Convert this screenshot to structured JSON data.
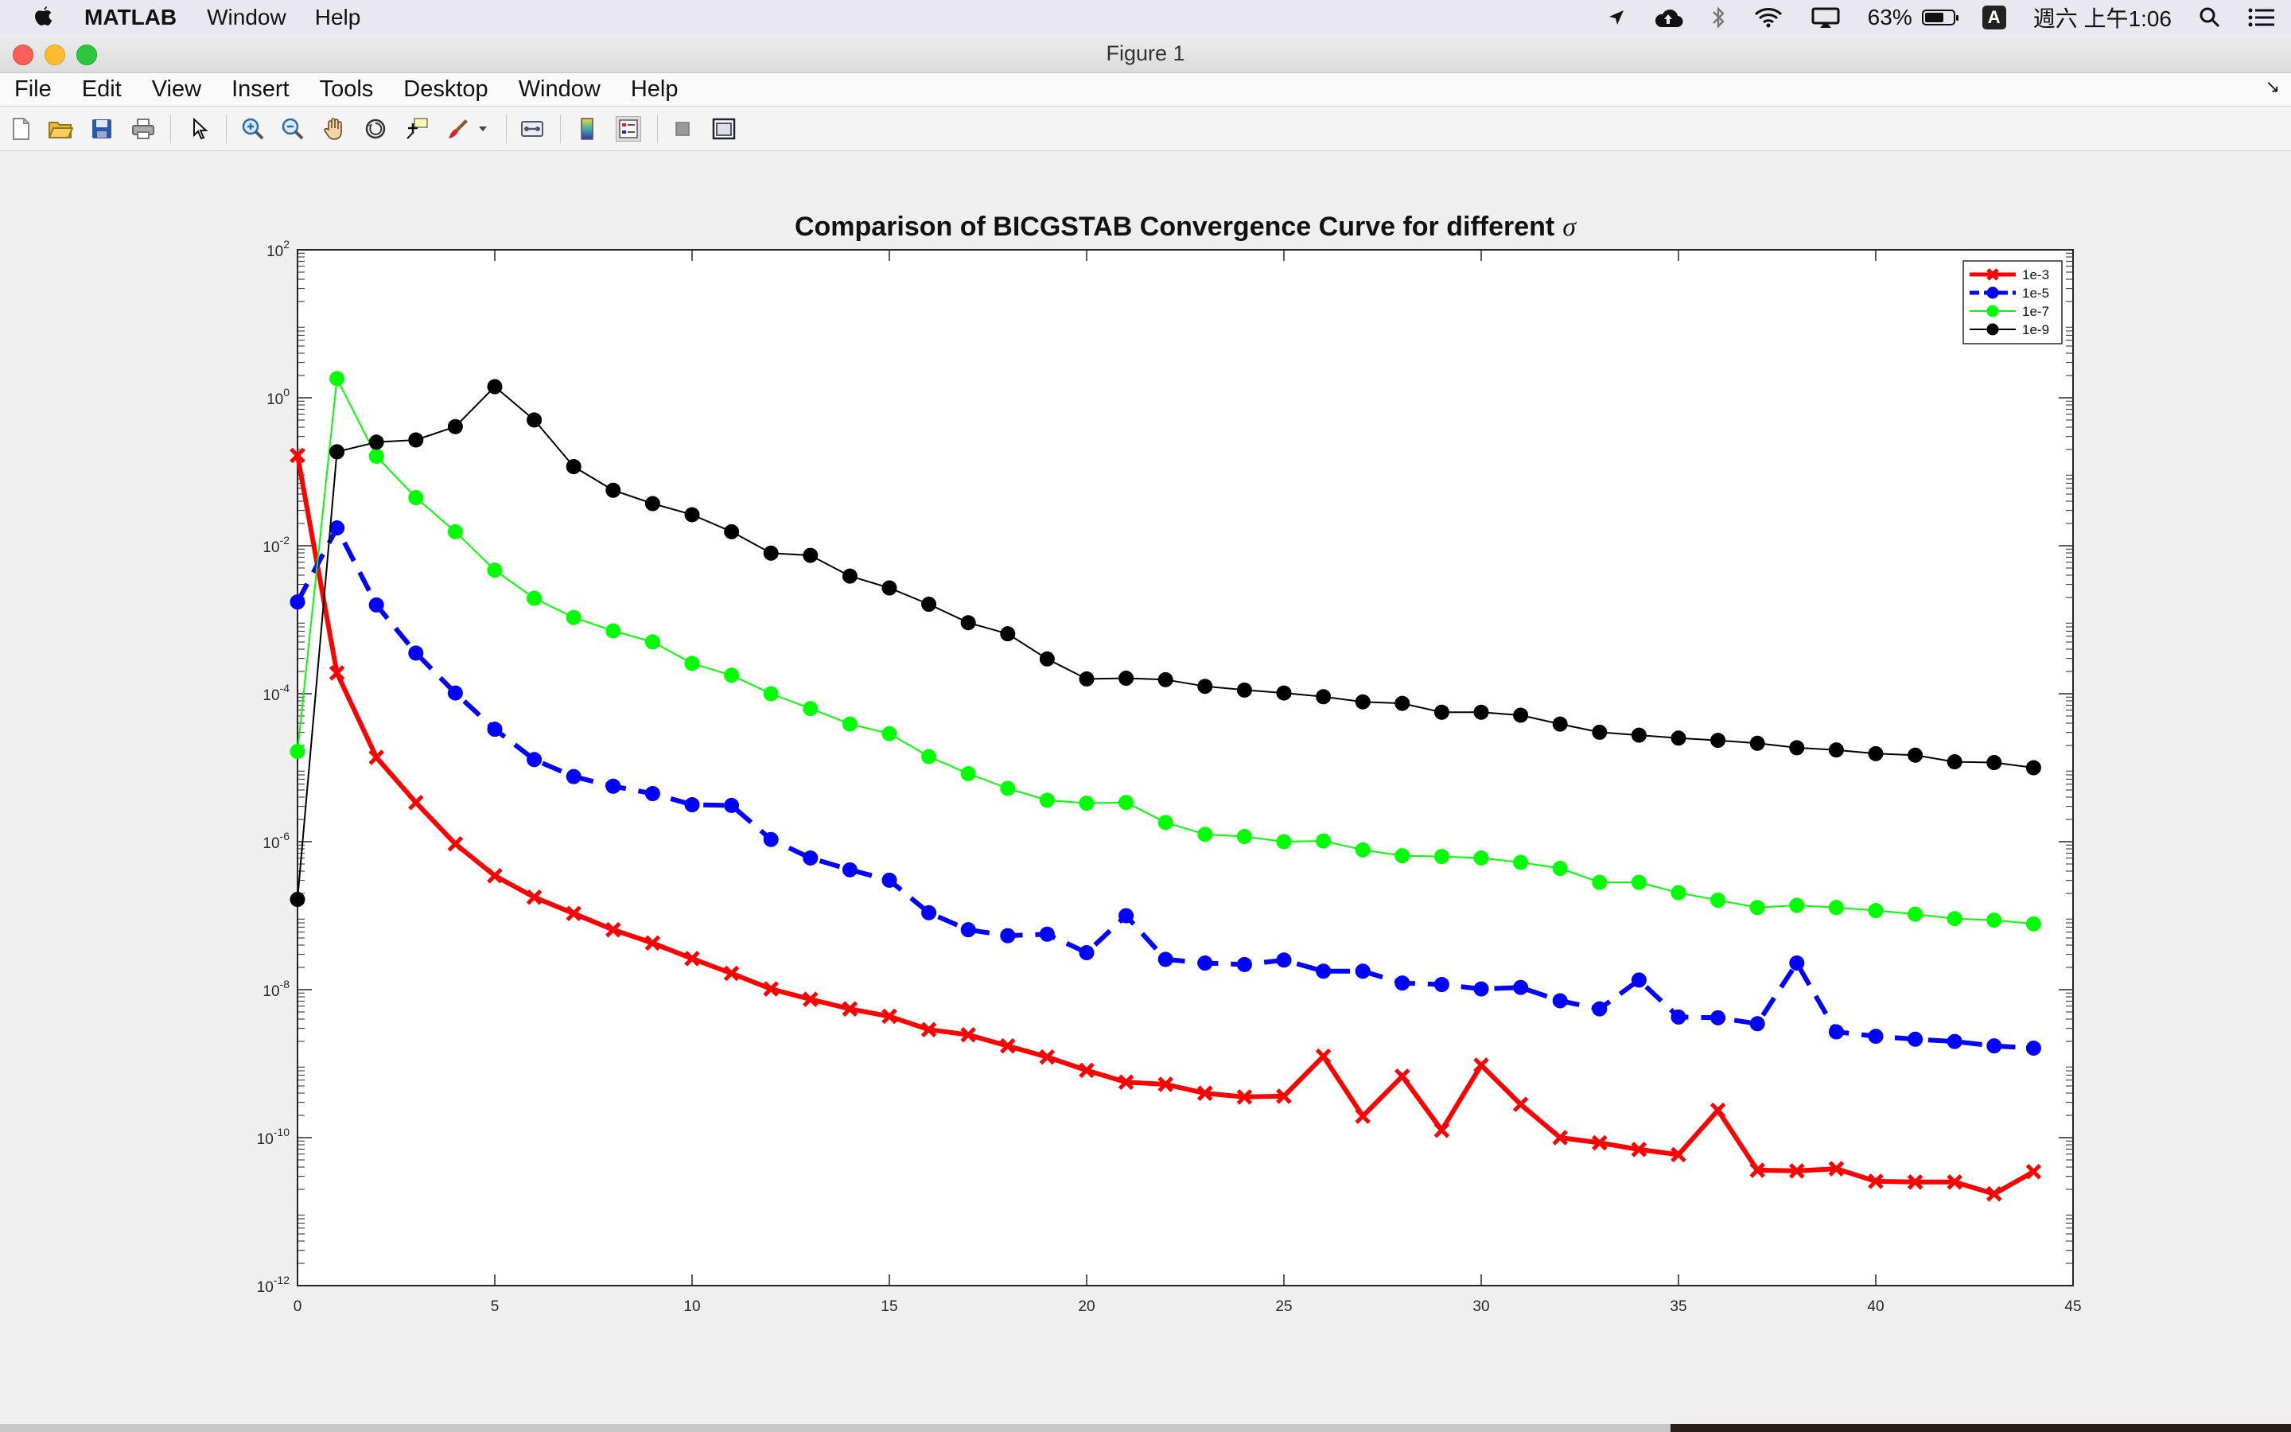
{
  "menubar": {
    "app_name": "MATLAB",
    "items": [
      "Window",
      "Help"
    ],
    "battery_percent": "63%",
    "input_method": "A",
    "clock": "週六 上午1:06"
  },
  "window": {
    "title": "Figure 1"
  },
  "figure_menu": [
    "File",
    "Edit",
    "View",
    "Insert",
    "Tools",
    "Desktop",
    "Window",
    "Help"
  ],
  "toolbar": {
    "buttons": [
      "new-figure",
      "open-file",
      "save-figure",
      "print-figure",
      "edit-plot",
      "zoom-in",
      "zoom-out",
      "pan",
      "rotate-3d",
      "data-cursor",
      "brush",
      "link-plot",
      "insert-colorbar",
      "insert-legend",
      "hide-plot-tools",
      "show-plot-tools"
    ]
  },
  "chart_data": {
    "type": "line",
    "title": "Comparison of BICGSTAB Convergence Curve for different",
    "title_symbol": "σ",
    "xlabel": "",
    "ylabel": "",
    "xlim": [
      0,
      45
    ],
    "ylim_exponent": [
      -12,
      2
    ],
    "yscale": "log",
    "x_ticks": [
      "0",
      "5",
      "10",
      "15",
      "20",
      "25",
      "30",
      "35",
      "40",
      "45"
    ],
    "y_tick_labels": [
      {
        "base": "10",
        "exp": "-12"
      },
      {
        "base": "10",
        "exp": "-10"
      },
      {
        "base": "10",
        "exp": "-8"
      },
      {
        "base": "10",
        "exp": "-6"
      },
      {
        "base": "10",
        "exp": "-4"
      },
      {
        "base": "10",
        "exp": "-2"
      },
      {
        "base": "10",
        "exp": "0"
      },
      {
        "base": "10",
        "exp": "2"
      }
    ],
    "grid": false,
    "legend_position": "top-right",
    "x": [
      0,
      1,
      2,
      3,
      4,
      5,
      6,
      7,
      8,
      9,
      10,
      11,
      12,
      13,
      14,
      15,
      16,
      17,
      18,
      19,
      20,
      21,
      22,
      23,
      24,
      25,
      26,
      27,
      28,
      29,
      30,
      31,
      32,
      33,
      34,
      35,
      36,
      37,
      38,
      39,
      40,
      41,
      42,
      43,
      44
    ],
    "series": [
      {
        "name": "1e-3",
        "color": "#ff0000",
        "marker": "x",
        "dashed": false,
        "width": 6,
        "log10_values": [
          -0.78,
          -3.72,
          -4.86,
          -5.47,
          -6.03,
          -6.46,
          -6.75,
          -6.97,
          -7.19,
          -7.37,
          -7.58,
          -7.78,
          -7.99,
          -8.13,
          -8.26,
          -8.36,
          -8.54,
          -8.61,
          -8.76,
          -8.91,
          -9.09,
          -9.25,
          -9.28,
          -9.4,
          -9.45,
          -9.44,
          -8.9,
          -9.71,
          -9.17,
          -9.9,
          -9.02,
          -9.55,
          -10.0,
          -10.07,
          -10.16,
          -10.23,
          -9.63,
          -10.44,
          -10.45,
          -10.42,
          -10.59,
          -10.6,
          -10.6,
          -10.76,
          -10.46
        ]
      },
      {
        "name": "1e-5",
        "color": "#0000ff",
        "marker": "o",
        "dashed": true,
        "width": 6,
        "log10_values": [
          -2.76,
          -1.76,
          -2.8,
          -3.45,
          -3.99,
          -4.48,
          -4.89,
          -5.12,
          -5.25,
          -5.35,
          -5.5,
          -5.51,
          -5.97,
          -6.22,
          -6.38,
          -6.52,
          -6.96,
          -7.19,
          -7.27,
          -7.25,
          -7.5,
          -7.0,
          -7.59,
          -7.64,
          -7.66,
          -7.6,
          -7.75,
          -7.75,
          -7.91,
          -7.93,
          -7.99,
          -7.97,
          -8.15,
          -8.26,
          -7.87,
          -8.37,
          -8.38,
          -8.46,
          -7.64,
          -8.57,
          -8.63,
          -8.67,
          -8.7,
          -8.76,
          -8.79
        ]
      },
      {
        "name": "1e-7",
        "color": "#00ff00",
        "marker": "o",
        "dashed": false,
        "width": 2,
        "log10_values": [
          -4.78,
          0.26,
          -0.79,
          -1.35,
          -1.81,
          -2.33,
          -2.71,
          -2.97,
          -3.15,
          -3.3,
          -3.59,
          -3.75,
          -4.0,
          -4.2,
          -4.41,
          -4.54,
          -4.85,
          -5.08,
          -5.28,
          -5.44,
          -5.48,
          -5.47,
          -5.74,
          -5.9,
          -5.93,
          -6.0,
          -5.99,
          -6.11,
          -6.19,
          -6.2,
          -6.22,
          -6.28,
          -6.36,
          -6.55,
          -6.55,
          -6.69,
          -6.79,
          -6.89,
          -6.86,
          -6.89,
          -6.93,
          -6.98,
          -7.04,
          -7.06,
          -7.11
        ]
      },
      {
        "name": "1e-9",
        "color": "#000000",
        "marker": "o",
        "dashed": false,
        "width": 2,
        "log10_values": [
          -6.78,
          -0.73,
          -0.6,
          -0.57,
          -0.39,
          0.15,
          -0.3,
          -0.93,
          -1.25,
          -1.43,
          -1.58,
          -1.81,
          -2.1,
          -2.13,
          -2.41,
          -2.57,
          -2.79,
          -3.04,
          -3.19,
          -3.53,
          -3.8,
          -3.79,
          -3.81,
          -3.9,
          -3.95,
          -3.99,
          -4.04,
          -4.11,
          -4.13,
          -4.25,
          -4.25,
          -4.29,
          -4.41,
          -4.52,
          -4.56,
          -4.6,
          -4.63,
          -4.67,
          -4.73,
          -4.76,
          -4.81,
          -4.83,
          -4.92,
          -4.93,
          -5.0
        ]
      }
    ]
  }
}
